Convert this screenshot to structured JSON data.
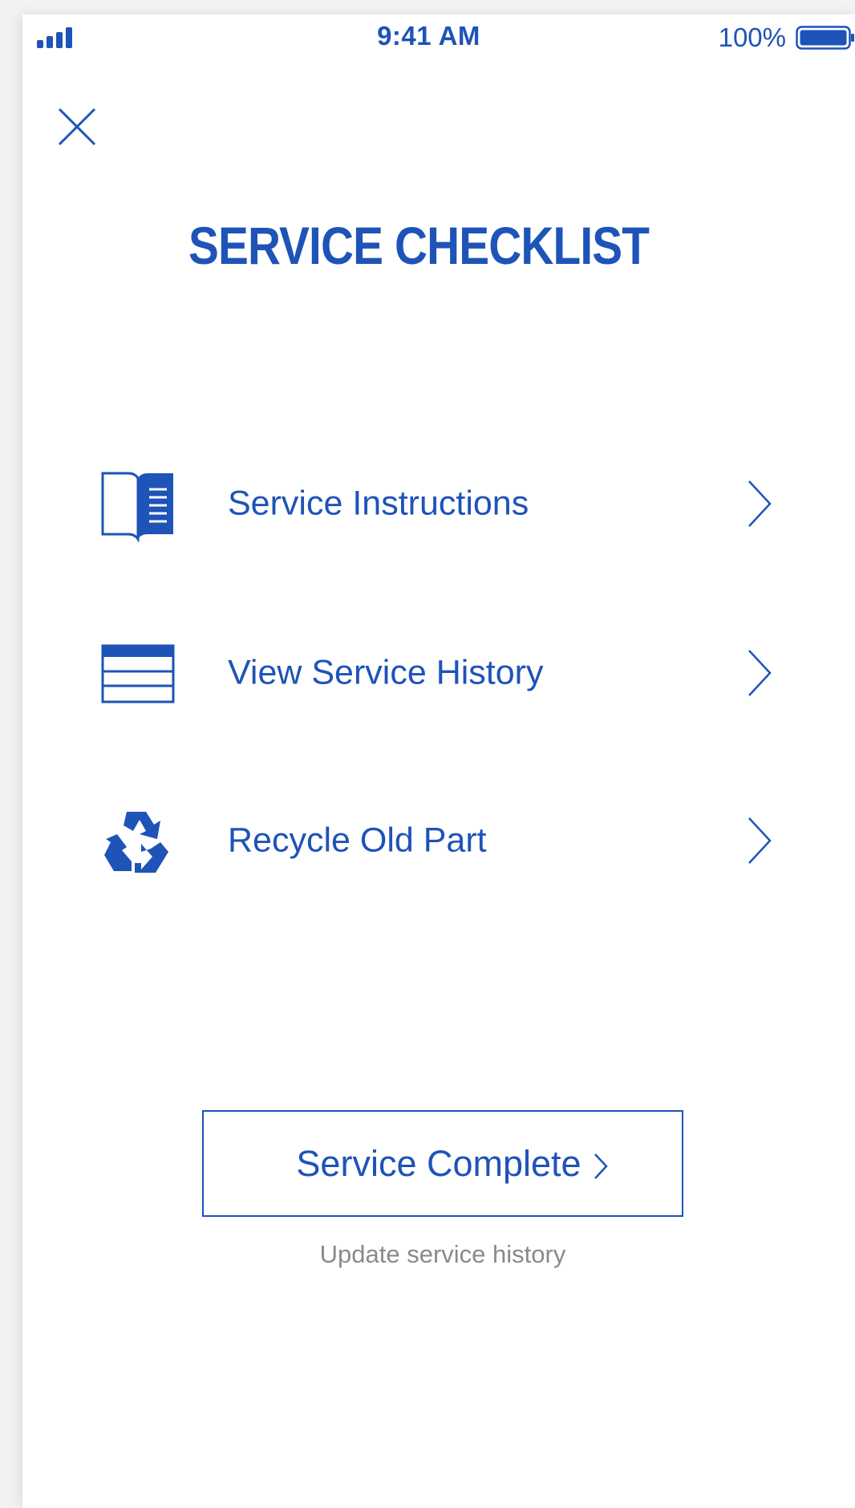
{
  "colors": {
    "accent": "#1e53b8",
    "subtext": "#8a8a8a",
    "background": "#ffffff"
  },
  "status_bar": {
    "time": "9:41 AM",
    "battery_percent": "100%",
    "signal_icon": "signal-bars-icon",
    "battery_icon": "battery-full-icon"
  },
  "header": {
    "close_icon": "close-icon",
    "title": "SERVICE CHECKLIST"
  },
  "menu": {
    "items": [
      {
        "label": "Service Instructions",
        "icon": "book-icon"
      },
      {
        "label": "View Service History",
        "icon": "table-icon"
      },
      {
        "label": "Recycle Old Part",
        "icon": "recycle-icon"
      }
    ]
  },
  "actions": {
    "complete_label": "Service Complete",
    "complete_subtext": "Update service history"
  }
}
